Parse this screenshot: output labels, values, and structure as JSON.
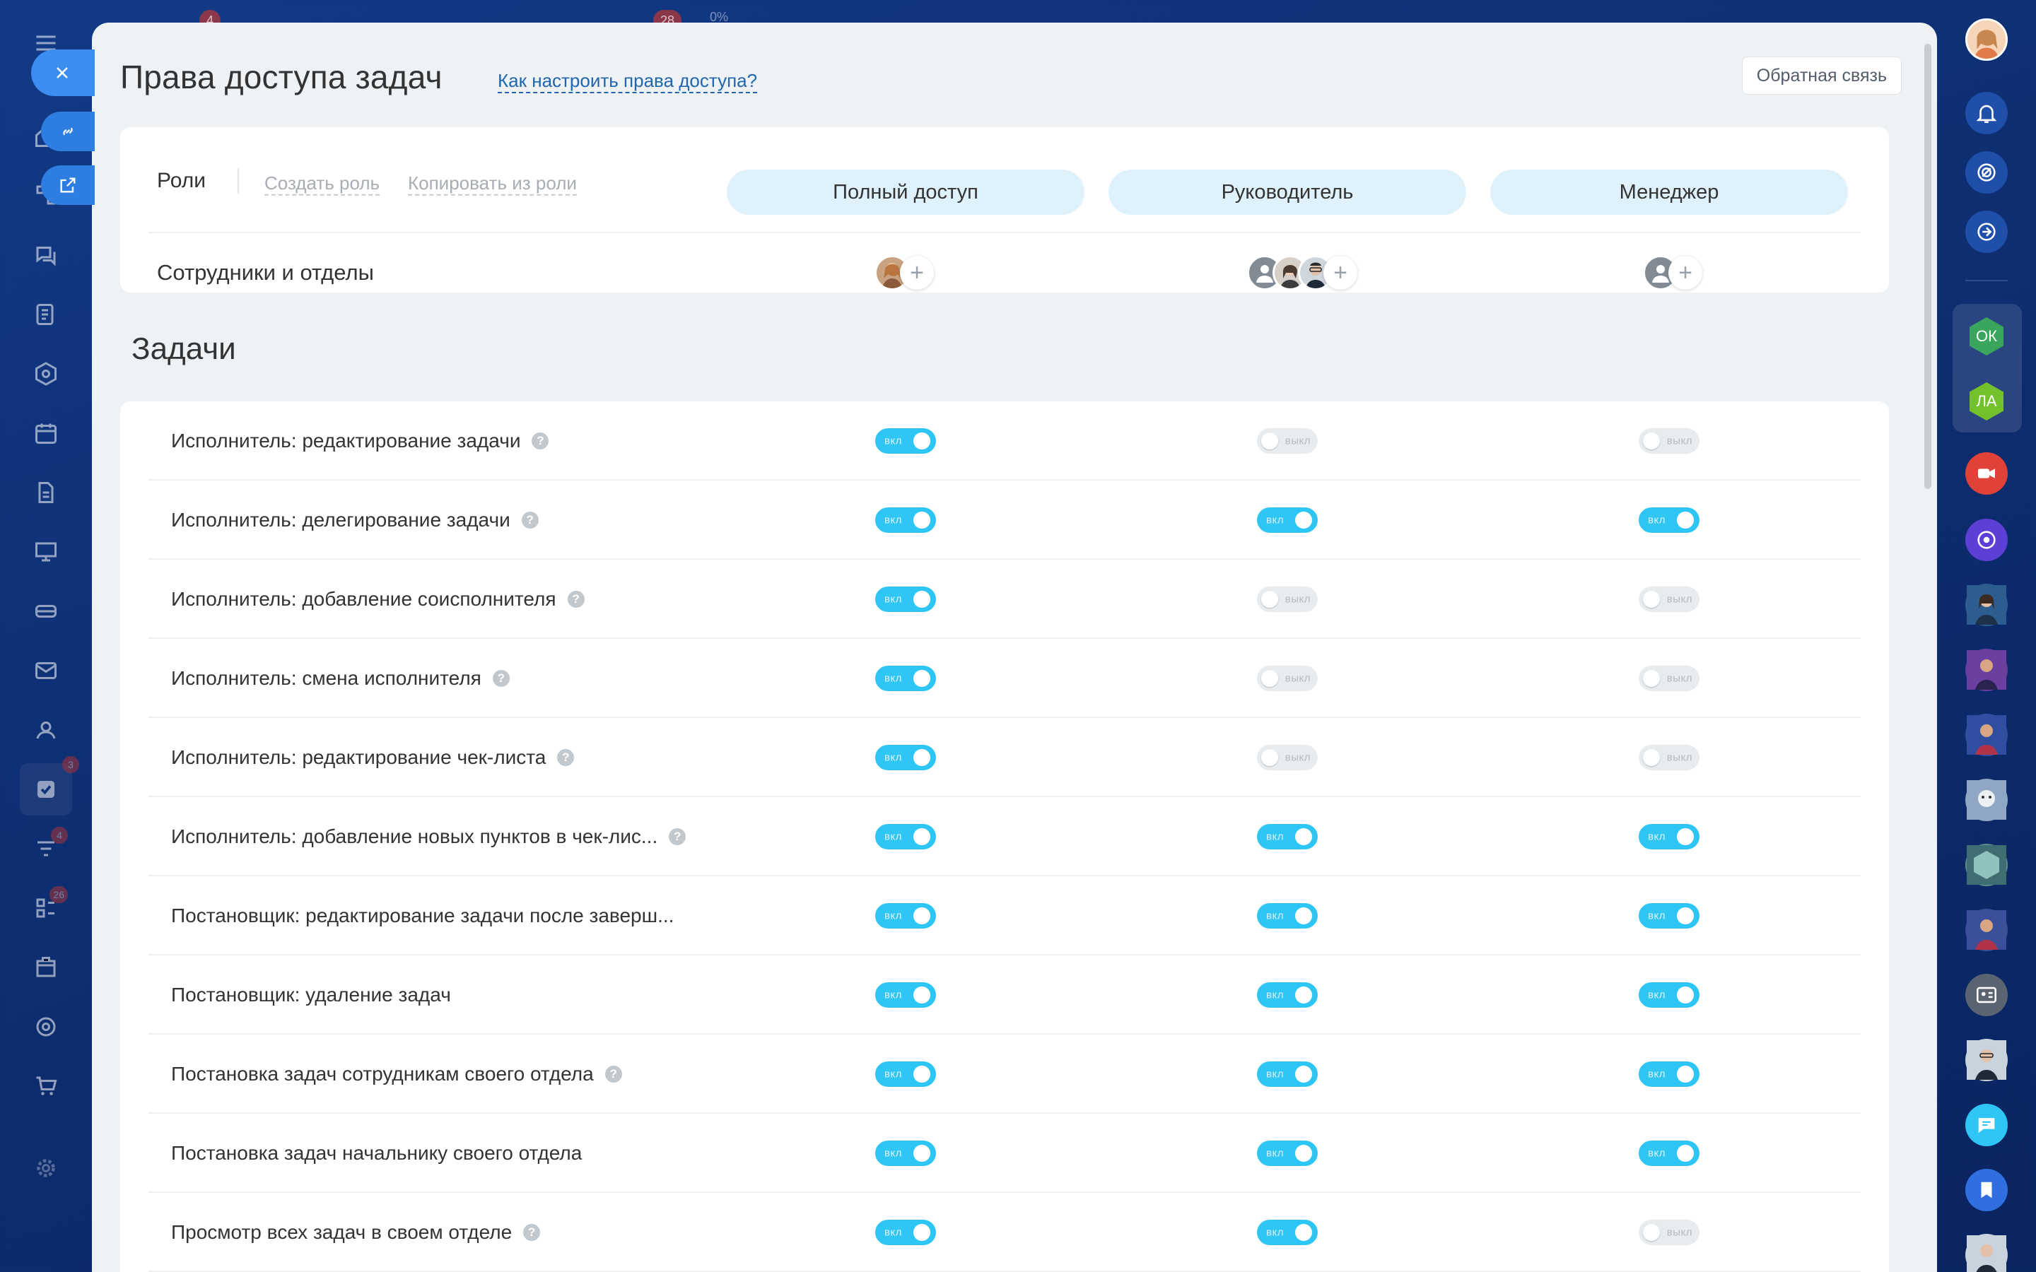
{
  "page": {
    "title": "Права доступа задач",
    "help_link": "Как настроить права доступа?",
    "feedback": "Обратная связь"
  },
  "roles": {
    "label": "Роли",
    "create": "Создать роль",
    "copy": "Копировать из роли",
    "items": [
      "Полный доступ",
      "Руководитель",
      "Менеджер"
    ],
    "employees_label": "Сотрудники и отделы"
  },
  "section": {
    "title": "Задачи"
  },
  "toggle_labels": {
    "on": "вкл",
    "off": "выкл"
  },
  "permissions": [
    {
      "label": "Исполнитель: редактирование задачи",
      "hint": true,
      "values": [
        true,
        false,
        false
      ]
    },
    {
      "label": "Исполнитель: делегирование задачи",
      "hint": true,
      "values": [
        true,
        true,
        true
      ]
    },
    {
      "label": "Исполнитель: добавление соисполнителя",
      "hint": true,
      "values": [
        true,
        false,
        false
      ]
    },
    {
      "label": "Исполнитель: смена исполнителя",
      "hint": true,
      "values": [
        true,
        false,
        false
      ]
    },
    {
      "label": "Исполнитель: редактирование чек-листа",
      "hint": true,
      "values": [
        true,
        false,
        false
      ]
    },
    {
      "label": "Исполнитель: добавление новых пунктов в чек-лис...",
      "hint": true,
      "values": [
        true,
        true,
        true
      ]
    },
    {
      "label": "Постановщик: редактирование задачи после заверш...",
      "hint": false,
      "values": [
        true,
        true,
        true
      ]
    },
    {
      "label": "Постановщик: удаление задач",
      "hint": false,
      "values": [
        true,
        true,
        true
      ]
    },
    {
      "label": "Постановка задач сотрудникам своего отдела",
      "hint": true,
      "values": [
        true,
        true,
        true
      ]
    },
    {
      "label": "Постановка задач начальнику своего отдела",
      "hint": false,
      "values": [
        true,
        true,
        true
      ]
    },
    {
      "label": "Просмотр всех задач в своем отделе",
      "hint": true,
      "values": [
        true,
        true,
        false
      ]
    }
  ],
  "left_rail": {
    "badges": {
      "tasks": "3",
      "feed": "4",
      "crm": "26"
    },
    "top_counters": [
      "4",
      "28",
      "0%"
    ]
  },
  "right_rail": {
    "group_chats": [
      "ОК",
      "ЛА"
    ]
  },
  "colors": {
    "accent": "#2fc6f6",
    "role_pill": "#dff2fb",
    "link": "#2066b0",
    "panel_bg": "#eef2f4"
  }
}
